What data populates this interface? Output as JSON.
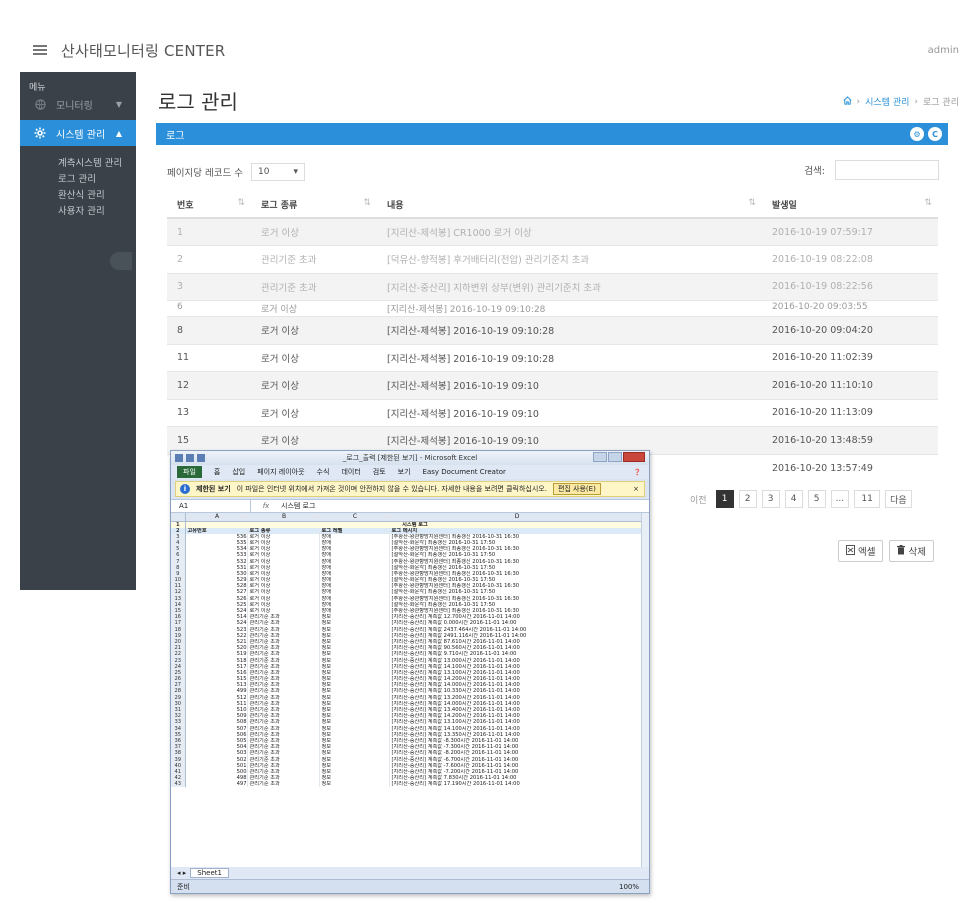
{
  "header": {
    "title": "산사태모니터링 CENTER",
    "user": "admin"
  },
  "sidebar": {
    "menu_label": "메뉴",
    "items": [
      {
        "label": "모니터링",
        "icon": "globe-icon",
        "active": false
      },
      {
        "label": "시스템 관리",
        "icon": "gear-icon",
        "active": true
      }
    ],
    "sub_items": [
      "계측시스템 관리",
      "로그 관리",
      "환산식 관리",
      "사용자 관리"
    ]
  },
  "page": {
    "title": "로그 관리",
    "breadcrumb": [
      "시스템 관리",
      "로그 관리"
    ],
    "panel_title": "로그",
    "per_page_label": "페이지당 레코드 수",
    "per_page_value": "10",
    "search_label": "검색:",
    "search_value": ""
  },
  "table": {
    "headers": [
      "번호",
      "로그 종류",
      "내용",
      "발생일"
    ],
    "rows": [
      {
        "no": "1",
        "type": "로거 이상",
        "content": "[지리산-제석봉] CR1000 로거 이상",
        "date": "2016-10-19 07:59:17"
      },
      {
        "no": "2",
        "type": "관리기준 초과",
        "content": "[덕유산-향적봉] 후거배터리(전압) 관리기준치 초과",
        "date": "2016-10-19 08:22:08"
      },
      {
        "no": "3",
        "type": "관리기준 초과",
        "content": "[지리산-중산리] 지하변위 상부(변위) 관리기준치 초과",
        "date": "2016-10-19 08:22:56"
      },
      {
        "no": "6",
        "type": "로거 이상",
        "content": "[지리산-제석봉] 2016-10-19 09:10:28",
        "date": "2016-10-20 09:03:55"
      },
      {
        "no": "8",
        "type": "로거 이상",
        "content": "[지리산-제석봉] 2016-10-19 09:10:28",
        "date": "2016-10-20 09:04:20"
      },
      {
        "no": "11",
        "type": "로거 이상",
        "content": "[지리산-제석봉] 2016-10-19 09:10:28",
        "date": "2016-10-20 11:02:39"
      },
      {
        "no": "12",
        "type": "로거 이상",
        "content": "[지리산-제석봉] 2016-10-19 09:10",
        "date": "2016-10-20 11:10:10"
      },
      {
        "no": "13",
        "type": "로거 이상",
        "content": "[지리산-제석봉] 2016-10-19 09:10",
        "date": "2016-10-20 11:13:09"
      },
      {
        "no": "15",
        "type": "로거 이상",
        "content": "[지리산-제석봉] 2016-10-19 09:10",
        "date": "2016-10-20 13:48:59"
      },
      {
        "no": "",
        "type": "",
        "content": "",
        "date": "2016-10-20 13:57:49"
      }
    ]
  },
  "pagination": {
    "prev": "이전",
    "pages": [
      "1",
      "2",
      "3",
      "4",
      "5",
      "...",
      "11"
    ],
    "next": "다음",
    "active": "1"
  },
  "actions": {
    "excel": "엑셀",
    "delete": "삭제"
  },
  "excel_window": {
    "title": "_로그_출력 [제한된 보기] - Microsoft Excel",
    "ribbon_tabs": [
      "파일",
      "홈",
      "삽입",
      "페이지 레이아웃",
      "수식",
      "데이터",
      "검토",
      "보기",
      "Easy Document Creator"
    ],
    "warning_title": "제한된 보기",
    "warning_text": "이 파일은 인터넷 위치에서 가져온 것이며 안전하지 않을 수 있습니다. 자세한 내용을 보려면 클릭하십시오.",
    "warning_button": "편집 사용(E)",
    "name_box": "A1",
    "formula": "시스템 로그",
    "columns": [
      "A",
      "B",
      "C",
      "D"
    ],
    "sheet_title": "시스템 로그",
    "sheet_headers": [
      "고유번호",
      "로그 종류",
      "로그 레벨",
      "로그 메시지"
    ],
    "sheet_rows": [
      [
        "536",
        "로거 이상",
        "장애",
        "[주왕산-왕관향방지원센터] 최종갱신 2016-10-31 16:30"
      ],
      [
        "535",
        "로거 이상",
        "장애",
        "[설악산-화운각] 최종갱신 2016-10-31 17:50"
      ],
      [
        "534",
        "로거 이상",
        "장애",
        "[주왕산-왕관향방지원센터] 최종갱신 2016-10-31 16:30"
      ],
      [
        "533",
        "로거 이상",
        "장애",
        "[설악산-화운각] 최종갱신 2016-10-31 17:50"
      ],
      [
        "532",
        "로거 이상",
        "장애",
        "[주왕산-왕관향방지원센터] 최종갱신 2016-10-31 16:30"
      ],
      [
        "531",
        "로거 이상",
        "장애",
        "[설악산-화운각] 최종갱신 2016-10-31 17:50"
      ],
      [
        "530",
        "로거 이상",
        "장애",
        "[주왕산-왕관향방지원센터] 최종갱신 2016-10-31 16:30"
      ],
      [
        "529",
        "로거 이상",
        "장애",
        "[설악산-화운각] 최종갱신 2016-10-31 17:50"
      ],
      [
        "528",
        "로거 이상",
        "장애",
        "[주왕산-왕관향방지원센터] 최종갱신 2016-10-31 16:30"
      ],
      [
        "527",
        "로거 이상",
        "장애",
        "[설악산-화운각] 최종갱신 2016-10-31 17:50"
      ],
      [
        "526",
        "로거 이상",
        "장애",
        "[주왕산-왕관향방지원센터] 최종갱신 2016-10-31 16:30"
      ],
      [
        "525",
        "로거 이상",
        "장애",
        "[설악산-화운각] 최종갱신 2016-10-31 17:50"
      ],
      [
        "524",
        "로거 이상",
        "장애",
        "[주왕산-왕관향방지원센터] 최종갱신 2016-10-31 16:30"
      ],
      [
        "514",
        "관리기준 초과",
        "정보",
        "[지리산-중산리] 계측값 12.700시간 2016-11-01 14:00"
      ],
      [
        "524",
        "관리기준 초과",
        "정보",
        "[지리산-중산리] 계측값 0.000시간 2016-11-01 14:00"
      ],
      [
        "523",
        "관리기준 초과",
        "정보",
        "[지리산-중산리] 계측값 2437.464시간 2016-11-01 14:00"
      ],
      [
        "522",
        "관리기준 초과",
        "정보",
        "[지리산-중산리] 계측값 2491.116시간 2016-11-01 14:00"
      ],
      [
        "521",
        "관리기준 초과",
        "정보",
        "[지리산-중산리] 계측값 87.610시간 2016-11-01 14:00"
      ],
      [
        "520",
        "관리기준 초과",
        "정보",
        "[지리산-중산리] 계측값 90.560시간 2016-11-01 14:00"
      ],
      [
        "519",
        "관리기준 초과",
        "정보",
        "[지리산-중산리] 계측값 9.710시간 2016-11-01 14:00"
      ],
      [
        "518",
        "관리기준 초과",
        "정보",
        "[지리산-중산리] 계측값 13.000시간 2016-11-01 14:00"
      ],
      [
        "517",
        "관리기준 초과",
        "정보",
        "[지리산-중산리] 계측값 14.100시간 2016-11-01 14:00"
      ],
      [
        "516",
        "관리기준 초과",
        "정보",
        "[지리산-중산리] 계측값 13.100시간 2016-11-01 14:00"
      ],
      [
        "515",
        "관리기준 초과",
        "정보",
        "[지리산-중산리] 계측값 14.200시간 2016-11-01 14:00"
      ],
      [
        "513",
        "관리기준 초과",
        "정보",
        "[지리산-중산리] 계측값 14.000시간 2016-11-01 14:00"
      ],
      [
        "499",
        "관리기준 초과",
        "정보",
        "[지리산-중산리] 계측값 10.330시간 2016-11-01 14:00"
      ],
      [
        "512",
        "관리기준 초과",
        "정보",
        "[지리산-중산리] 계측값 13.200시간 2016-11-01 14:00"
      ],
      [
        "511",
        "관리기준 초과",
        "정보",
        "[지리산-중산리] 계측값 14.000시간 2016-11-01 14:00"
      ],
      [
        "510",
        "관리기준 초과",
        "정보",
        "[지리산-중산리] 계측값 13.400시간 2016-11-01 14:00"
      ],
      [
        "509",
        "관리기준 초과",
        "정보",
        "[지리산-중산리] 계측값 14.200시간 2016-11-01 14:00"
      ],
      [
        "508",
        "관리기준 초과",
        "정보",
        "[지리산-중산리] 계측값 13.100시간 2016-11-01 14:00"
      ],
      [
        "507",
        "관리기준 초과",
        "정보",
        "[지리산-중산리] 계측값 14.100시간 2016-11-01 14:00"
      ],
      [
        "506",
        "관리기준 초과",
        "정보",
        "[지리산-중산리] 계측값 13.350시간 2016-11-01 14:00"
      ],
      [
        "505",
        "관리기준 초과",
        "정보",
        "[지리산-중산리] 계측값 -8.300시간 2016-11-01 14:00"
      ],
      [
        "504",
        "관리기준 초과",
        "정보",
        "[지리산-중산리] 계측값 -7.300시간 2016-11-01 14:00"
      ],
      [
        "503",
        "관리기준 초과",
        "정보",
        "[지리산-중산리] 계측값 -8.200시간 2016-11-01 14:00"
      ],
      [
        "502",
        "관리기준 초과",
        "정보",
        "[지리산-중산리] 계측값 -6.700시간 2016-11-01 14:00"
      ],
      [
        "501",
        "관리기준 초과",
        "정보",
        "[지리산-중산리] 계측값 -7.600시간 2016-11-01 14:00"
      ],
      [
        "500",
        "관리기준 초과",
        "정보",
        "[지리산-중산리] 계측값 -7.200시간 2016-11-01 14:00"
      ],
      [
        "498",
        "관리기준 초과",
        "정보",
        "[지리산-중산리] 계측값 7.830시간 2016-11-01 14:00"
      ],
      [
        "497",
        "관리기준 초과",
        "정보",
        "[지리산-중산리] 계측값 17.190시간 2016-11-01 14:00"
      ]
    ],
    "sheet_tab": "Sheet1",
    "status": "준비",
    "zoom": "100%"
  },
  "colors": {
    "accent": "#2b90d9",
    "sidebar_bg": "#3a4148",
    "active_page": "#333333"
  }
}
